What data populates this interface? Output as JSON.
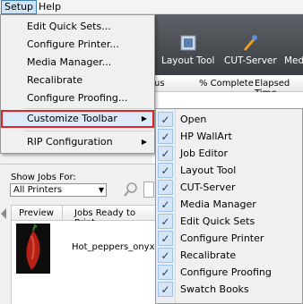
{
  "menubar": {
    "setup": "Setup",
    "help": "Help"
  },
  "toolbar": {
    "layout_tool": "Layout Tool",
    "cut_server": "CUT-Server",
    "media_partial": "Med"
  },
  "job_grid_header": {
    "status_partial": "us",
    "complete": "% Complete",
    "elapsed": "Elapsed Time"
  },
  "jobs_panel": {
    "show_jobs_for": "Show Jobs For:",
    "printer_filter": "All Printers",
    "col_preview": "Preview",
    "col_jobs": "Jobs Ready to Print",
    "job_name": "Hot_peppers_onyx"
  },
  "setup_menu": {
    "items": [
      "Edit Quick Sets...",
      "Configure Printer...",
      "Media Manager...",
      "Recalibrate",
      "Configure Proofing...",
      "Customize Toolbar",
      "RIP Configuration"
    ]
  },
  "customize_toolbar": {
    "check_glyph": "✓",
    "items": [
      "Open",
      "HP WallArt",
      "Job Editor",
      "Layout Tool",
      "CUT-Server",
      "Media Manager",
      "Edit Quick Sets",
      "Configure Printer",
      "Recalibrate",
      "Configure Proofing",
      "Swatch Books"
    ]
  },
  "colors": {
    "highlight_outline": "#e0242a",
    "menu_hover": "#dde9f7",
    "check_bg": "#d5e5f6"
  }
}
